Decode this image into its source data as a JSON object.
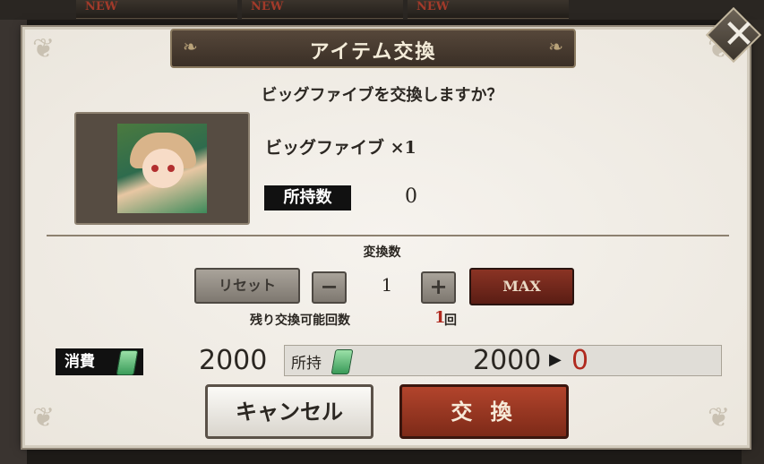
{
  "background": {
    "tab_badges": [
      "NEW",
      "NEW",
      "NEW"
    ]
  },
  "dialog": {
    "title": "アイテム交換",
    "question": "ビッグファイブを交換しますか？",
    "item": {
      "name": "ビッグファイブ ×1",
      "owned_label": "所持数",
      "owned_value": "0"
    },
    "quantity": {
      "label": "変換数",
      "reset_label": "リセット",
      "minus_label": "−",
      "value": "1",
      "plus_label": "+",
      "max_label": "MAX"
    },
    "remaining": {
      "label": "残り交換可能回数",
      "count": "1",
      "unit": "回"
    },
    "cost": {
      "label": "消費",
      "value": "2000",
      "balance_label": "所持",
      "balance_before": "2000",
      "balance_after": "0"
    },
    "buttons": {
      "cancel": "キャンセル",
      "exchange": "交 換"
    },
    "close_icon": "close-icon"
  },
  "colors": {
    "accent_red": "#b02a1f",
    "max_button": "#8a3324",
    "exchange_button": "#b2442c",
    "ticket_green": "#3a9b59"
  }
}
